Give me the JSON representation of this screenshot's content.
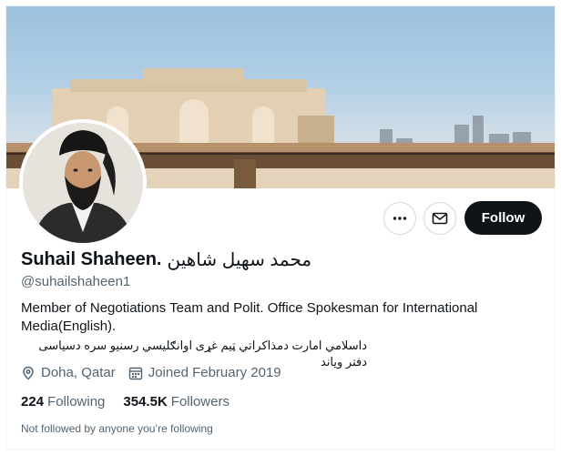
{
  "profile": {
    "name": "Suhail Shaheen.",
    "name_arabic": "محمد سهیل شاهین",
    "handle": "@suhailshaheen1",
    "bio": "Member of Negotiations Team and Polit. Office Spokesman for International Media(English).",
    "bio_pashto": "داسلامي امارت دمذاکراتي ټیم غړی اوانګلیسي رسنیو سره دسیاسی دفتر ویاند",
    "location": "Doha, Qatar",
    "joined": "Joined February 2019",
    "following_count": "224",
    "following_label": "Following",
    "followers_count": "354.5K",
    "followers_label": "Followers",
    "not_followed_text": "Not followed by anyone you’re following"
  },
  "actions": {
    "more_icon": "more-horizontal-icon",
    "message_icon": "envelope-icon",
    "follow_label": "Follow"
  },
  "icons": {
    "location": "location-pin-icon",
    "calendar": "calendar-icon"
  },
  "colors": {
    "text_primary": "#0f1419",
    "text_secondary": "#536471",
    "border": "#cfd9de",
    "follow_bg": "#0f1419",
    "follow_text": "#ffffff"
  }
}
